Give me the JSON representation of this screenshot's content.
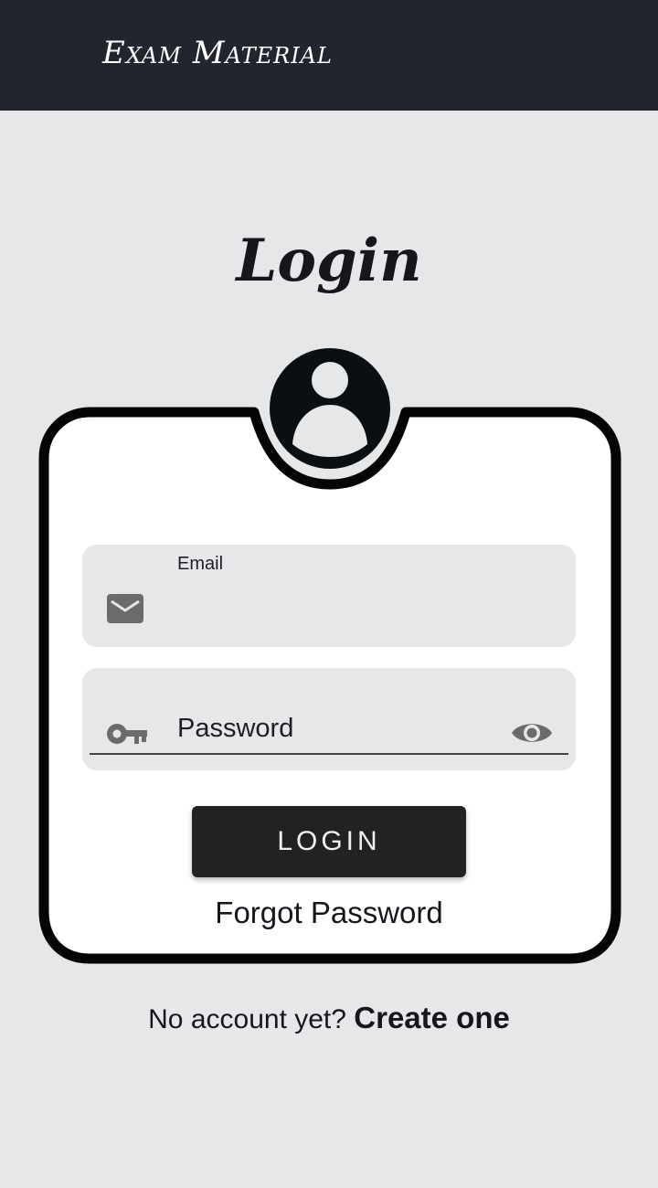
{
  "app_bar": {
    "title": "Exam Material"
  },
  "page": {
    "title": "Login"
  },
  "form": {
    "email": {
      "label": "Email",
      "value": "",
      "icon": "mail-icon"
    },
    "password": {
      "placeholder": "Password",
      "icon": "key-icon",
      "toggle_icon": "eye-icon"
    },
    "login_button": "LOGIN",
    "forgot_link": "Forgot Password"
  },
  "footer": {
    "prompt": "No account yet?",
    "create_link": "Create one"
  },
  "colors": {
    "app_bar": "#22252e",
    "background": "#e6e7e9",
    "button": "#222223",
    "icon": "#6b6b6b"
  }
}
